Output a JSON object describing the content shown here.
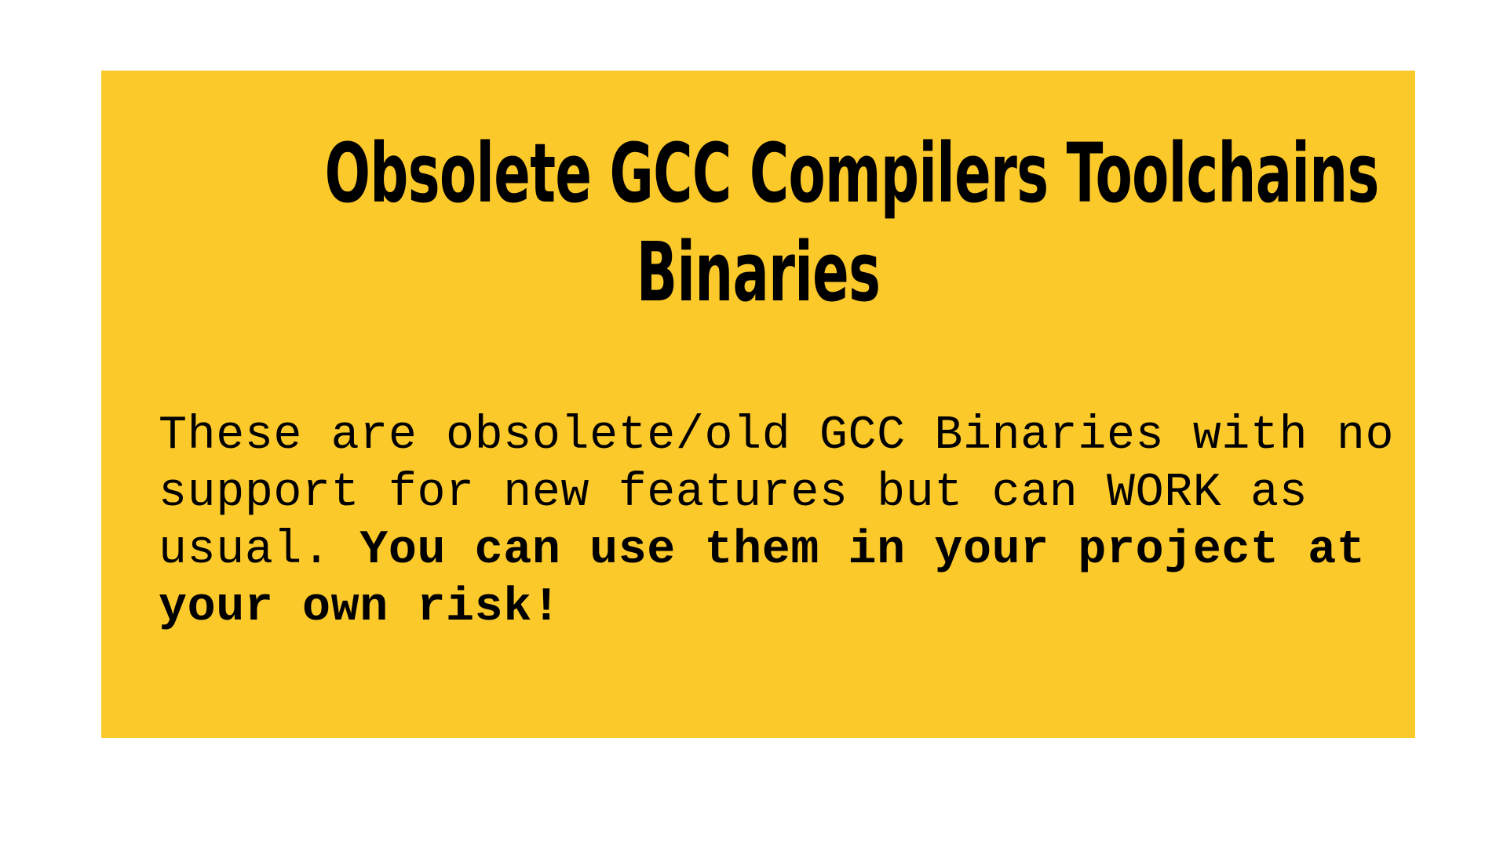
{
  "panel": {
    "background_color": "#fcc92b",
    "title_line1": "Obsolete GCC Compilers Toolchains",
    "title_line2": "Binaries",
    "notice_regular": "These are obsolete/old GCC Binaries with no support for new features but can WORK as usual. ",
    "notice_bold": "You can use them in your project at your own risk!"
  }
}
